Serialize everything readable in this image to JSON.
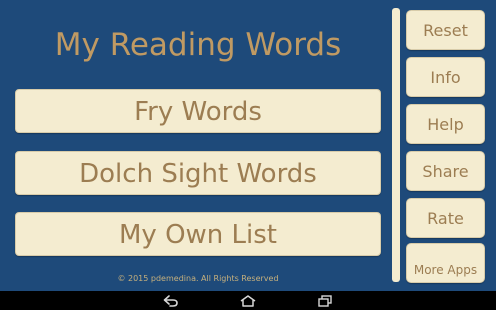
{
  "app": {
    "title": "My Reading Words"
  },
  "main": {
    "buttons": [
      {
        "label": "Fry Words"
      },
      {
        "label": "Dolch Sight Words"
      },
      {
        "label": "My Own List"
      }
    ],
    "copyright": "© 2015 pdemedina. All Rights Reserved"
  },
  "sidebar": {
    "buttons": [
      {
        "label": "Reset"
      },
      {
        "label": "Info"
      },
      {
        "label": "Help"
      },
      {
        "label": "Share"
      },
      {
        "label": "Rate"
      },
      {
        "label": "More Apps"
      }
    ]
  },
  "navbar": {
    "icons": [
      "back-icon",
      "home-icon",
      "recent-apps-icon"
    ]
  },
  "colors": {
    "background": "#1e4a7a",
    "button_fill": "#f4ecd0",
    "button_text": "#9c7d52",
    "title_text": "#c09a63"
  }
}
